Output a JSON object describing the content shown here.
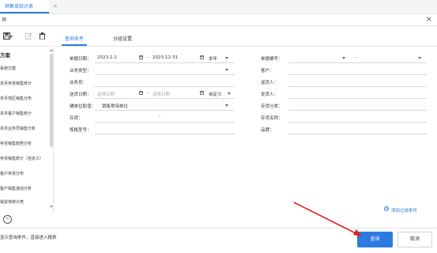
{
  "window": {
    "tab_label": "销售单统计表",
    "tab_close": "×",
    "dialog_title": "询",
    "dialog_close": "×"
  },
  "toolbar": {
    "save_icon": "save-icon",
    "edit_icon": "edit-icon",
    "delete_icon": "trash-icon"
  },
  "sidebar": {
    "header": "方案",
    "items": [
      {
        "label": "系统方案"
      },
      {
        "label": "本月存货销售统计"
      },
      {
        "label": "本月地区销售分布"
      },
      {
        "label": "本月客户销售统计"
      },
      {
        "label": "本月业务员销售分析"
      },
      {
        "label": "存货销售趋势分析"
      },
      {
        "label": "存货销售统计（自定义）"
      },
      {
        "label": "客户存货分布"
      },
      {
        "label": "客户销售波动分析"
      },
      {
        "label": "销货单统计表"
      }
    ]
  },
  "tabs": [
    {
      "label": "查询条件",
      "active": true
    },
    {
      "label": "分组设置",
      "active": false
    }
  ],
  "form": {
    "doc_date_label": "单据日期：",
    "doc_date_from": "2023-1-1",
    "doc_date_sep": "-",
    "doc_date_to": "2023-12-31",
    "doc_date_period": "本年",
    "biz_type_label": "业务类型：",
    "salesman_label": "业务员：",
    "ship_date_label": "送货日期：",
    "ship_date_from_ph": "选择日期",
    "ship_date_sep": "-",
    "ship_date_to_ph": "选择日期",
    "ship_date_period": "自定义",
    "aux_unit_label": "辅单位取值：",
    "aux_unit_value": "销售常用单位",
    "inventory_label": "存货：",
    "inventory_sep": "-",
    "spec_label": "规格型号：",
    "doc_no_label": "单据编号：",
    "doc_no_sep": "-",
    "customer_label": "客户：",
    "shipper_label": "送货人：",
    "sender_label": "发货人：",
    "inv_category_label": "存货分类：",
    "inv_name_label": "存货名称：",
    "brand_label": "品牌："
  },
  "add_filter": "添加过滤条件",
  "footer": {
    "hint": "显示查询条件，直接进入报表",
    "query_button": "查询",
    "cancel_button": "取消"
  },
  "colors": {
    "accent": "#2d7be0",
    "annotation_arrow": "#e02020"
  }
}
